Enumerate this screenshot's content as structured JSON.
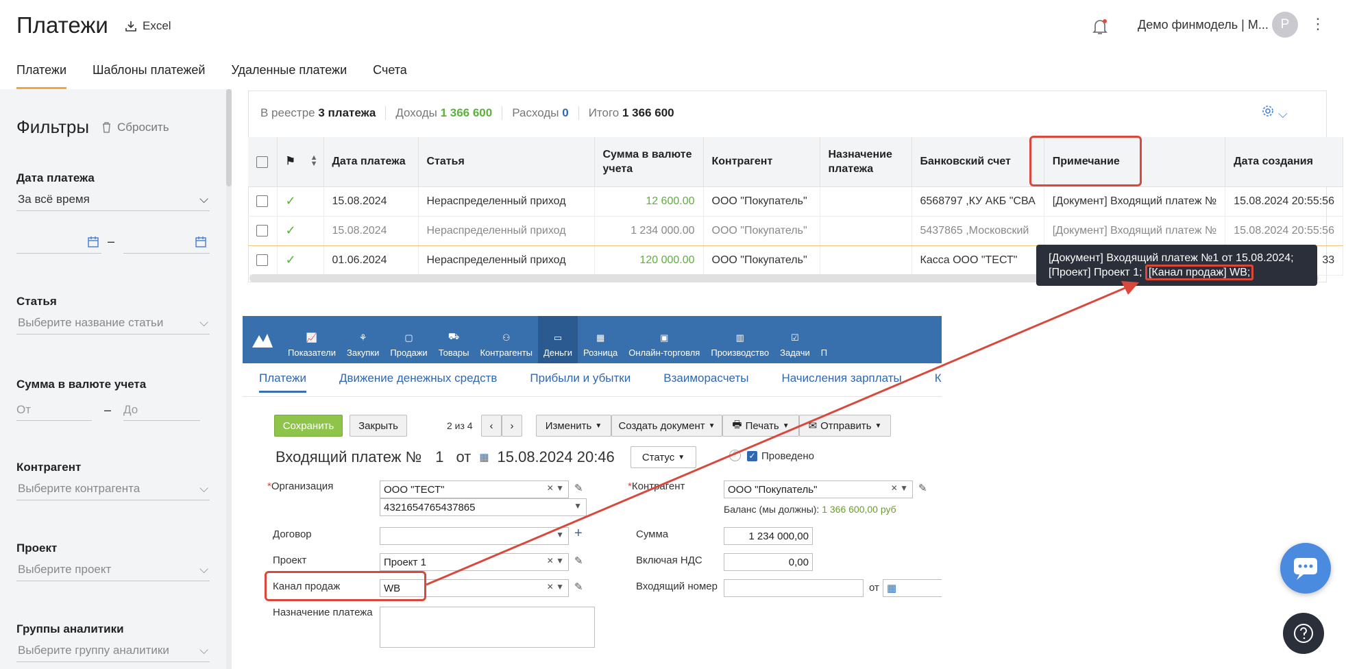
{
  "header": {
    "title": "Платежи",
    "excel_label": "Excel",
    "user_name": "Демо финмодель | М...",
    "avatar_letter": "Р",
    "more_icon": "⋮"
  },
  "nav": {
    "tabs": [
      "Платежи",
      "Шаблоны платежей",
      "Удаленные платежи",
      "Счета"
    ],
    "active": 0
  },
  "filters": {
    "title": "Фильтры",
    "reset_label": "Сбросить",
    "date_label": "Дата платежа",
    "date_value": "За всё время",
    "date_sep": "–",
    "article_label": "Статья",
    "article_placeholder": "Выберите название статьи",
    "amount_label": "Сумма в валюте учета",
    "amount_from": "От",
    "amount_dash": "–",
    "amount_to": "До",
    "contractor_label": "Контрагент",
    "contractor_placeholder": "Выберите контрагента",
    "project_label": "Проект",
    "project_placeholder": "Выберите проект",
    "analytics_label": "Группы аналитики",
    "analytics_placeholder": "Выберите группу аналитики"
  },
  "summary": {
    "registry_label": "В реестре",
    "registry_value": "3 платежа",
    "income_label": "Доходы",
    "income_value": "1 366 600",
    "expense_label": "Расходы",
    "expense_value": "0",
    "total_label": "Итого",
    "total_value": "1 366 600"
  },
  "table": {
    "columns": [
      "Дата платежа",
      "Статья",
      "Сумма в валюте учета",
      "Контрагент",
      "Назначение платежа",
      "Банковский счет",
      "Примечание",
      "Дата создания"
    ],
    "rows": [
      {
        "date": "15.08.2024",
        "article": "Нераспределенный приход",
        "amount": "12 600.00",
        "contractor": "ООО \"Покупатель\"",
        "purpose": "",
        "account": "6568797 ,КУ АКБ \"СВА",
        "note": "[Документ] Входящий платеж №",
        "created": "15.08.2024 20:55:56"
      },
      {
        "date": "15.08.2024",
        "article": "Нераспределенный приход",
        "amount": "1 234 000.00",
        "contractor": "ООО \"Покупатель\"",
        "purpose": "",
        "account": "5437865 ,Московский",
        "note": "[Документ] Входящий платеж №",
        "created": "15.08.2024 20:55:56"
      },
      {
        "date": "01.06.2024",
        "article": "Нераспределенный приход",
        "amount": "120 000.00",
        "contractor": "ООО \"Покупатель\"",
        "purpose": "",
        "account": "Касса ООО \"ТЕСТ\"",
        "note": "",
        "created": "33"
      }
    ]
  },
  "tooltip": {
    "line1": "[Документ] Входящий платеж №1 от 15.08.2024;",
    "line2_prefix": "[Проект] Проект 1;",
    "line2_highlight": "[Канал продаж] WB;"
  },
  "ms": {
    "nav": [
      "Показатели",
      "Закупки",
      "Продажи",
      "Товары",
      "Контрагенты",
      "Деньги",
      "Розница",
      "Онлайн-торговля",
      "Производство",
      "Задачи",
      "П"
    ],
    "nav_active": 5,
    "tabs": [
      "Платежи",
      "Движение денежных средств",
      "Прибыли и убытки",
      "Взаиморасчеты",
      "Начисления зарплаты",
      "Корре"
    ],
    "save": "Сохранить",
    "close": "Закрыть",
    "pager": "2 из 4",
    "edit": "Изменить",
    "create_doc": "Создать документ",
    "print": "Печать",
    "send": "Отправить",
    "doc_title": "Входящий платеж №",
    "doc_number": "1",
    "doc_from": "от",
    "doc_date": "15.08.2024 20:46",
    "status": "Статус",
    "conducted": "Проведено",
    "org_label": "Организация",
    "org_value": "ООО \"ТЕСТ\"",
    "org_account": "4321654765437865",
    "contract_label": "Договор",
    "project_label": "Проект",
    "project_value": "Проект 1",
    "channel_label": "Канал продаж",
    "channel_value": "WB",
    "purpose_label": "Назначение платежа",
    "contractor_label": "Контрагент",
    "contractor_value": "ООО \"Покупатель\"",
    "balance_label": "Баланс (мы должны):",
    "balance_value": "1 366 600,00 руб",
    "sum_label": "Сумма",
    "sum_value": "1 234 000,00",
    "vat_label": "Включая НДС",
    "vat_value": "0,00",
    "incoming_label": "Входящий номер",
    "incoming_from": "от"
  },
  "colors": {
    "accent": "#f0a83c",
    "green": "#5db03c",
    "red_highlight": "#d9483b",
    "ms_blue": "#3870ae"
  }
}
